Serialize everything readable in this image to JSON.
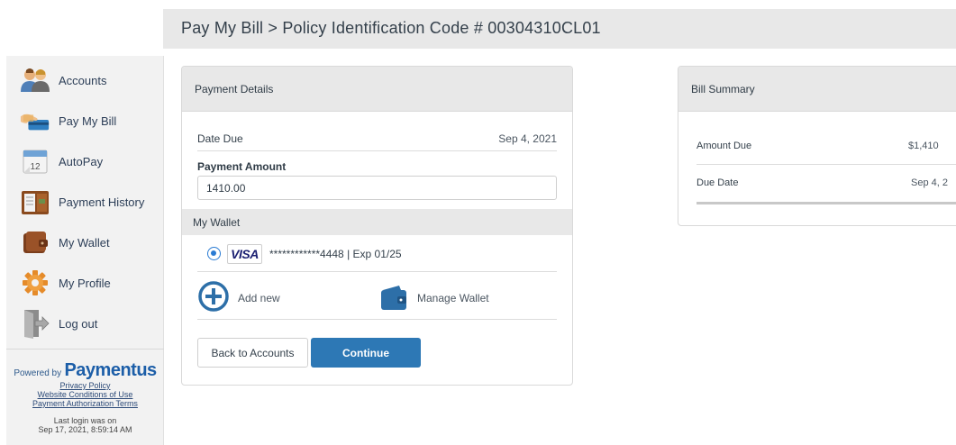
{
  "header": {
    "title": "Pay My Bill > Policy Identification Code # 00304310CL01"
  },
  "sidebar": {
    "items": [
      {
        "label": "Accounts",
        "icon": "accounts-icon"
      },
      {
        "label": "Pay My Bill",
        "icon": "pay-bill-icon"
      },
      {
        "label": "AutoPay",
        "icon": "calendar-icon"
      },
      {
        "label": "Payment History",
        "icon": "history-icon"
      },
      {
        "label": "My Wallet",
        "icon": "wallet-icon"
      },
      {
        "label": "My Profile",
        "icon": "gear-icon"
      },
      {
        "label": "Log out",
        "icon": "logout-icon"
      }
    ],
    "powered_by": "Powered by",
    "brand": "Paymentus",
    "links": [
      "Privacy Policy",
      "Website Conditions of Use",
      "Payment Authorization Terms"
    ],
    "last_login_line1": "Last login was on",
    "last_login_line2": "Sep 17, 2021, 8:59:14 AM"
  },
  "payment_details": {
    "heading": "Payment Details",
    "date_due_label": "Date Due",
    "date_due_value": "Sep 4, 2021",
    "amount_label": "Payment Amount",
    "amount_value": "1410.00",
    "wallet_heading": "My Wallet",
    "card_brand": "VISA",
    "card_text": "************4448 | Exp 01/25",
    "add_new": "Add new",
    "manage_wallet": "Manage Wallet",
    "back_button": "Back to Accounts",
    "continue_button": "Continue"
  },
  "bill_summary": {
    "heading": "Bill Summary",
    "amount_due_label": "Amount Due",
    "amount_due_value": "$1,410",
    "due_date_label": "Due Date",
    "due_date_value": "Sep 4, 2"
  },
  "colors": {
    "primary": "#2d78b5",
    "header_bg": "#e8e8e8",
    "sidebar_bg": "#f2f2f2",
    "radio": "#2a7bd3"
  }
}
